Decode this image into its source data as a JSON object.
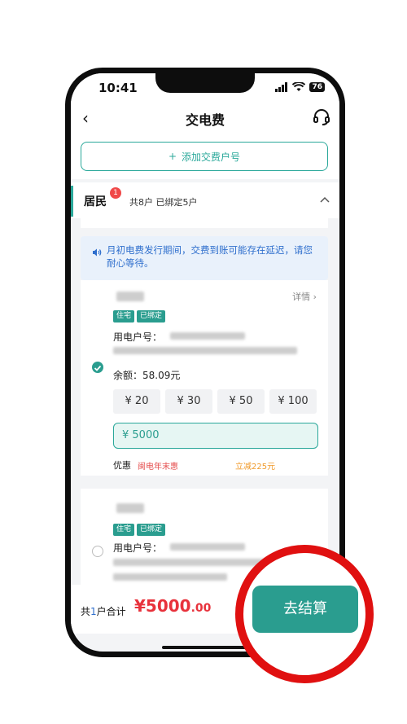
{
  "status_bar": {
    "time": "10:41",
    "battery": "76"
  },
  "nav": {
    "back": "‹",
    "title": "交电费",
    "service_icon": "headset-icon"
  },
  "add_account": {
    "label": "添加交费户号",
    "plus": "+"
  },
  "section": {
    "name": "居民",
    "badge": "1",
    "summary": "共8户 已绑定5户"
  },
  "notice": {
    "text": "月初电费发行期间，交费到账可能存在延迟，请您耐心等待。"
  },
  "accounts": [
    {
      "details_label": "详情",
      "tags": [
        "住宅",
        "已绑定"
      ],
      "account_label": "用电户号：",
      "balance_label": "余额：",
      "balance_value": "58.09元",
      "selected": true,
      "amount_options": [
        "¥ 20",
        "¥ 30",
        "¥ 50",
        "¥ 100"
      ],
      "custom_amount": "¥ 5000",
      "promo_label": "优惠",
      "promo_name": "闽电年末惠",
      "promo_save": "立减225元"
    },
    {
      "tags": [
        "住宅",
        "已绑定"
      ],
      "account_label": "用电户号：",
      "selected": false
    }
  ],
  "footer": {
    "total_prefix": "共",
    "total_count": "1",
    "total_suffix": "户合计",
    "currency": "¥",
    "amount_int": "5000",
    "amount_dec": ".00",
    "checkout_label": "去结算"
  },
  "colors": {
    "accent": "#2a9d8f",
    "price": "#e8323c",
    "notice": "#2f6fcd",
    "highlight_ring": "#e01010"
  }
}
